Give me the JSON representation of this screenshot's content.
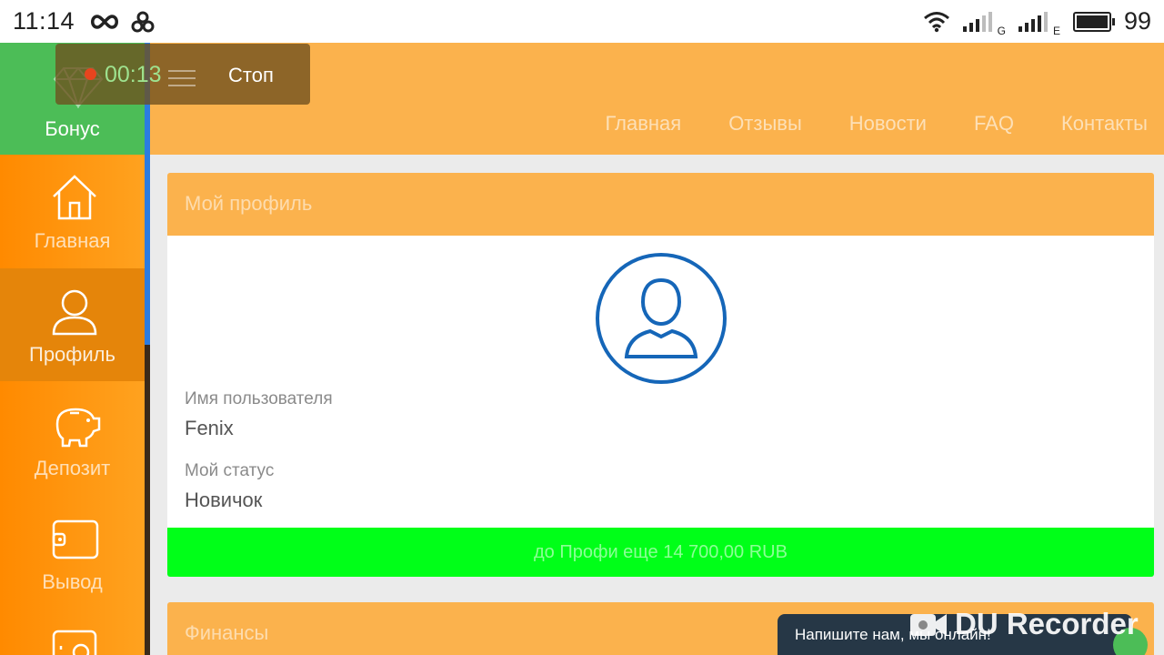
{
  "status_bar": {
    "time": "11:14",
    "battery": "99",
    "net_label_1": "G",
    "net_label_2": "E"
  },
  "recorder": {
    "elapsed": "00:13",
    "stop_label": "Стоп",
    "watermark": "DU Recorder"
  },
  "sidebar": {
    "bonus_label": "Бонус",
    "items": [
      {
        "label": "Главная",
        "icon": "home-icon"
      },
      {
        "label": "Профиль",
        "icon": "user-icon",
        "active": true
      },
      {
        "label": "Депозит",
        "icon": "piggy-bank-icon"
      },
      {
        "label": "Вывод",
        "icon": "wallet-icon"
      }
    ]
  },
  "nav": {
    "links": [
      "Главная",
      "Отзывы",
      "Новости",
      "FAQ",
      "Контакты"
    ]
  },
  "profile_card": {
    "title": "Мой профиль",
    "username_label": "Имя пользователя",
    "username": "Fenix",
    "status_label": "Мой статус",
    "status": "Новичок",
    "progress_text": "до Профи еще 14 700,00 RUB"
  },
  "finance_card": {
    "title": "Финансы"
  },
  "chat": {
    "prompt": "Напишите нам, мы онлайн!"
  },
  "colors": {
    "sidebar": "#ff8a00",
    "bonus": "#4cbd57",
    "header": "#fbb24d",
    "progress": "#00ff18",
    "avatar_ring": "#1566b8",
    "chat": "#263746"
  }
}
